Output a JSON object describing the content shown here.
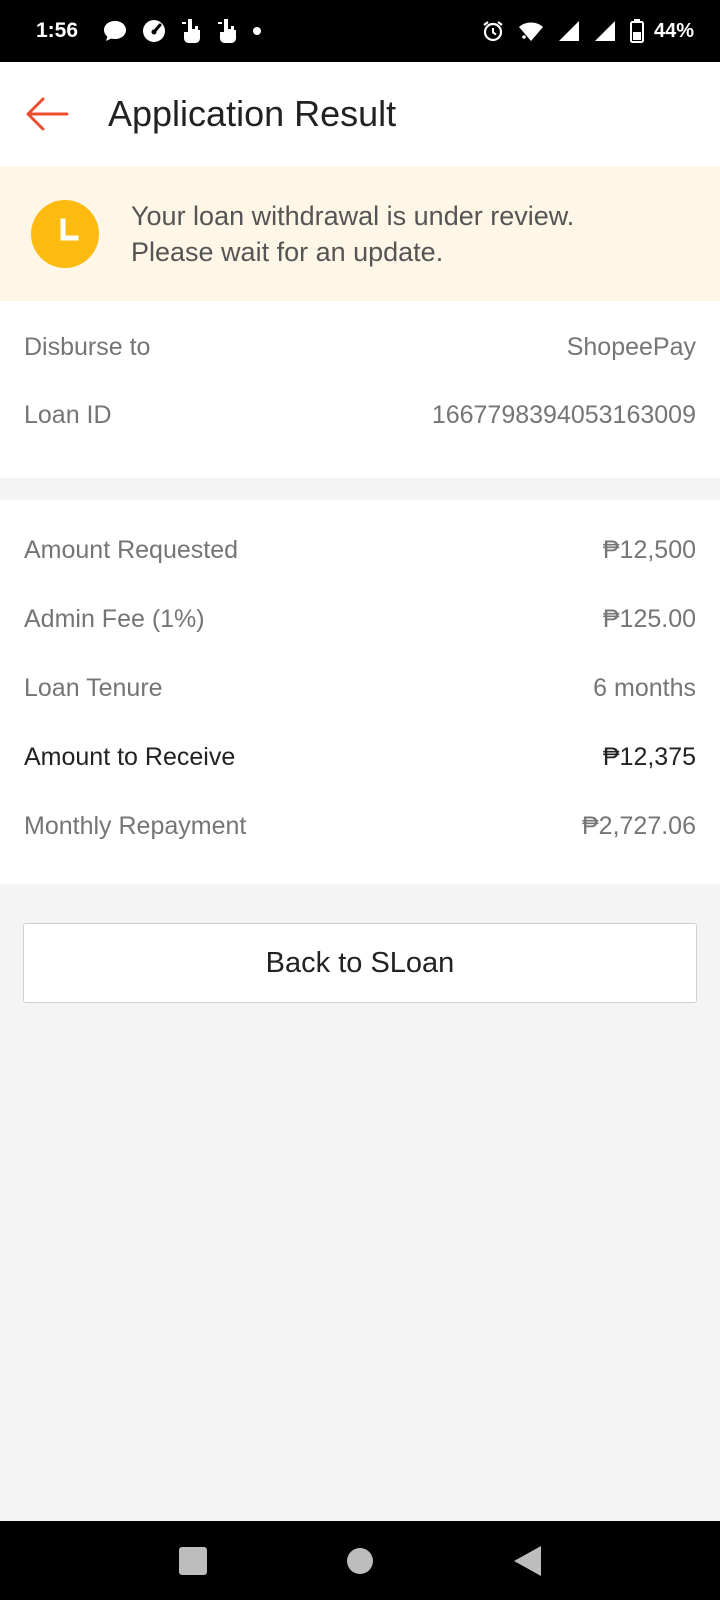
{
  "status_bar": {
    "time": "1:56",
    "battery": "44%",
    "icons_left": [
      "chat-bubble-icon",
      "speedometer-icon",
      "touch-hand-icon",
      "touch-hand-icon",
      "dot-icon"
    ],
    "icons_right": [
      "alarm-icon",
      "wifi-icon",
      "signal-icon",
      "signal-icon",
      "battery-icon"
    ]
  },
  "header": {
    "title": "Application Result",
    "accent_color": "#ee4d2d"
  },
  "banner": {
    "line1": "Your loan withdrawal is under review.",
    "line2": "Please wait for an update.",
    "icon": "clock-icon",
    "icon_color": "#fdbb11"
  },
  "disbursement": {
    "rows": [
      {
        "label": "Disburse to",
        "value": "ShopeePay"
      },
      {
        "label": "Loan ID",
        "value": "1667798394053163009"
      }
    ]
  },
  "loan_details": {
    "rows": [
      {
        "label": "Amount Requested",
        "value": "₱12,500"
      },
      {
        "label": "Admin Fee (1%)",
        "value": "₱125.00"
      },
      {
        "label": "Loan Tenure",
        "value": "6 months"
      },
      {
        "label": "Amount to Receive",
        "value": "₱12,375"
      },
      {
        "label": "Monthly Repayment",
        "value": "₱2,727.06"
      }
    ]
  },
  "actions": {
    "back_label": "Back to SLoan"
  },
  "nav_bar": {
    "buttons": [
      "recents-square-icon",
      "home-circle-icon",
      "back-triangle-icon"
    ]
  }
}
